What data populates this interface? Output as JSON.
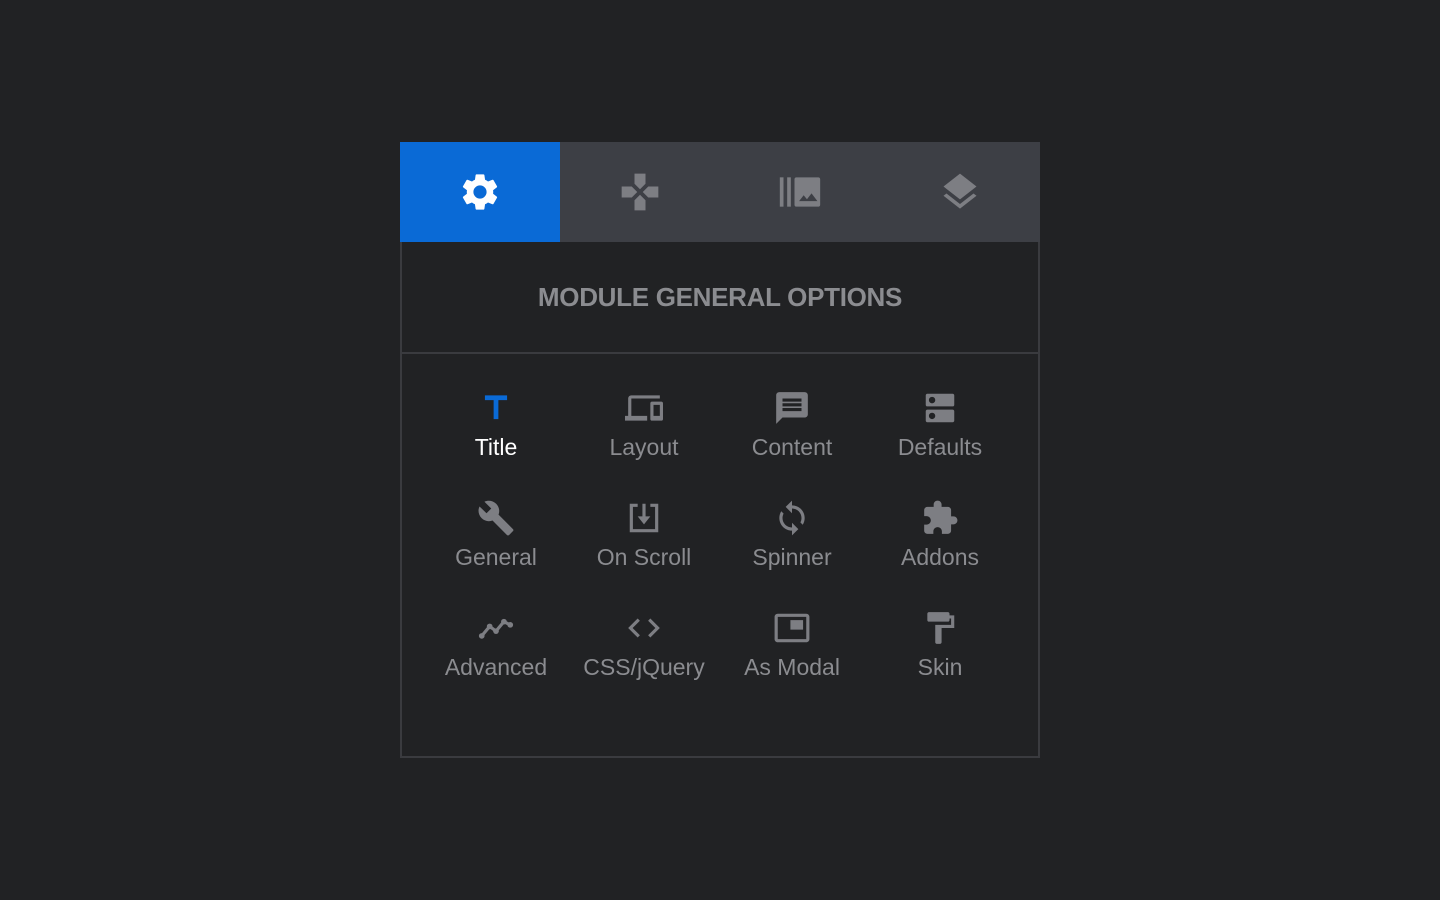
{
  "tabs": [
    {
      "icon": "gear-icon",
      "active": true
    },
    {
      "icon": "gamepad-icon",
      "active": false
    },
    {
      "icon": "gallery-icon",
      "active": false
    },
    {
      "icon": "layers-icon",
      "active": false
    }
  ],
  "section_title": "MODULE GENERAL OPTIONS",
  "options": [
    {
      "label": "Title",
      "icon": "title-icon",
      "active": true
    },
    {
      "label": "Layout",
      "icon": "devices-icon",
      "active": false
    },
    {
      "label": "Content",
      "icon": "message-icon",
      "active": false
    },
    {
      "label": "Defaults",
      "icon": "dns-icon",
      "active": false
    },
    {
      "label": "General",
      "icon": "wrench-icon",
      "active": false
    },
    {
      "label": "On Scroll",
      "icon": "scroll-download-icon",
      "active": false
    },
    {
      "label": "Spinner",
      "icon": "sync-icon",
      "active": false
    },
    {
      "label": "Addons",
      "icon": "puzzle-icon",
      "active": false
    },
    {
      "label": "Advanced",
      "icon": "trend-icon",
      "active": false
    },
    {
      "label": "CSS/jQuery",
      "icon": "code-icon",
      "active": false
    },
    {
      "label": "As Modal",
      "icon": "modal-window-icon",
      "active": false
    },
    {
      "label": "Skin",
      "icon": "paint-roller-icon",
      "active": false
    }
  ],
  "colors": {
    "background": "#212224",
    "tab_bar": "#3d3f45",
    "active_tab": "#0a6ad6",
    "accent": "#0a6ad6",
    "inactive_icon": "#7d7e83",
    "label": "#8b8c90",
    "active_label": "#ffffff"
  }
}
